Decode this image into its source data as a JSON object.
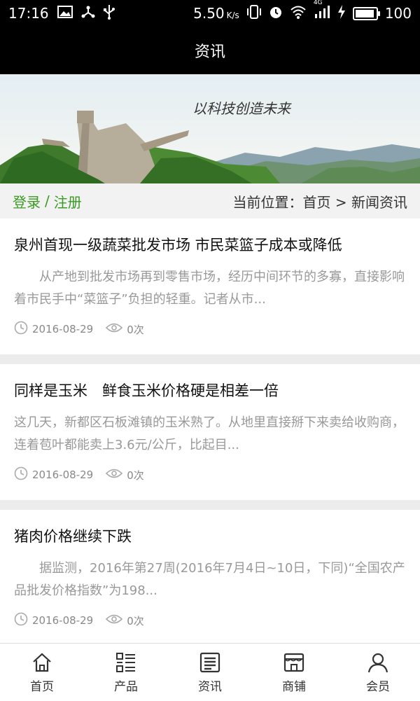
{
  "status_bar": {
    "time": "17:16",
    "net_speed": "5.50",
    "net_unit": "K/s",
    "battery": "100",
    "net_type": "4G"
  },
  "app_bar": {
    "title": "资讯"
  },
  "banner": {
    "calligraphy": "以科技创造未来"
  },
  "location_bar": {
    "login": "登录",
    "separator": "/",
    "register": "注册",
    "current_location": "当前位置：首页 > 新闻资讯"
  },
  "news": [
    {
      "title": "泉州首现一级蔬菜批发市场 市民菜篮子成本或降低",
      "excerpt": "　　从产地到批发市场再到零售市场，经历中间环节的多寡，直接影响着市民手中“菜篮子”负担的轻重。记者从市...",
      "date": "2016-08-29",
      "views": "0次"
    },
    {
      "title": "同样是玉米　鲜食玉米价格硬是相差一倍",
      "excerpt": "这几天，新都区石板滩镇的玉米熟了。从地里直接掰下来卖给收购商，连着苞叶都能卖上3.6元/公斤，比起目...",
      "date": "2016-08-29",
      "views": "0次"
    },
    {
      "title": "猪肉价格继续下跌",
      "excerpt": "　　据监测，2016年第27周(2016年7月4日~10日，下同)“全国农产品批发价格指数”为198...",
      "date": "2016-08-29",
      "views": "0次"
    }
  ],
  "tabs": [
    {
      "label": "首页",
      "icon": "home-icon"
    },
    {
      "label": "产品",
      "icon": "grid-list-icon"
    },
    {
      "label": "资讯",
      "icon": "news-icon"
    },
    {
      "label": "商铺",
      "icon": "shop-icon"
    },
    {
      "label": "会员",
      "icon": "user-icon"
    }
  ],
  "colors": {
    "accent_green": "#3a9a24",
    "app_bar": "#000000"
  }
}
